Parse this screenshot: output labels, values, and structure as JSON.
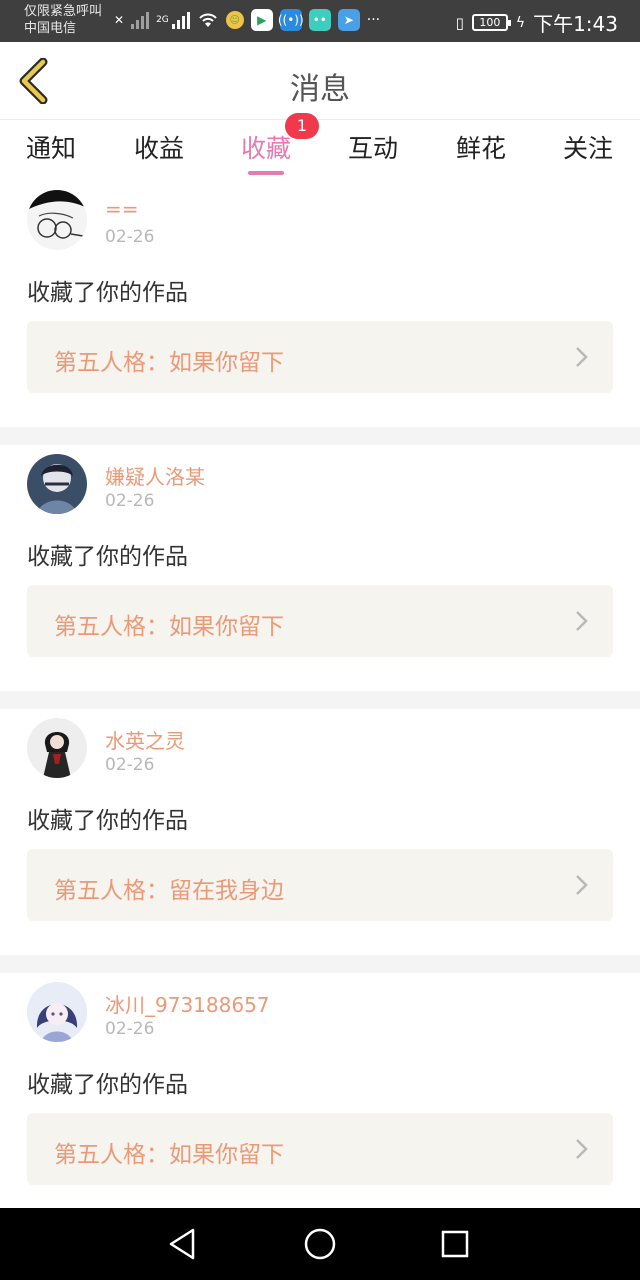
{
  "status_bar": {
    "line1": "仅限紧急呼叫",
    "line2": "中国电信",
    "network": "2G",
    "more": "···",
    "battery": "100",
    "time": "下午1:43"
  },
  "header": {
    "title": "消息"
  },
  "tabs": [
    {
      "label": "通知"
    },
    {
      "label": "收益"
    },
    {
      "label": "收藏",
      "badge": "1",
      "active": true
    },
    {
      "label": "互动"
    },
    {
      "label": "鲜花"
    },
    {
      "label": "关注"
    }
  ],
  "messages": [
    {
      "user": "==",
      "date": "02-26",
      "action": "收藏了你的作品",
      "work": "第五人格：如果你留下"
    },
    {
      "user": "嫌疑人洛某",
      "date": "02-26",
      "action": "收藏了你的作品",
      "work": "第五人格：如果你留下"
    },
    {
      "user": "水英之灵",
      "date": "02-26",
      "action": "收藏了你的作品",
      "work": "第五人格：留在我身边"
    },
    {
      "user": "冰川_973188657",
      "date": "02-26",
      "action": "收藏了你的作品",
      "work": "第五人格：如果你留下"
    }
  ],
  "colors": {
    "accent_pink": "#e57bb0",
    "name_orange": "#eb9a78",
    "badge_red": "#f0394b",
    "back_arrow": "#c9a43a"
  },
  "icons": {
    "back": "back-arrow-icon",
    "chevron": "chevron-right-icon",
    "nav_back": "triangle-back-icon",
    "nav_home": "circle-home-icon",
    "nav_recent": "square-recent-icon"
  }
}
